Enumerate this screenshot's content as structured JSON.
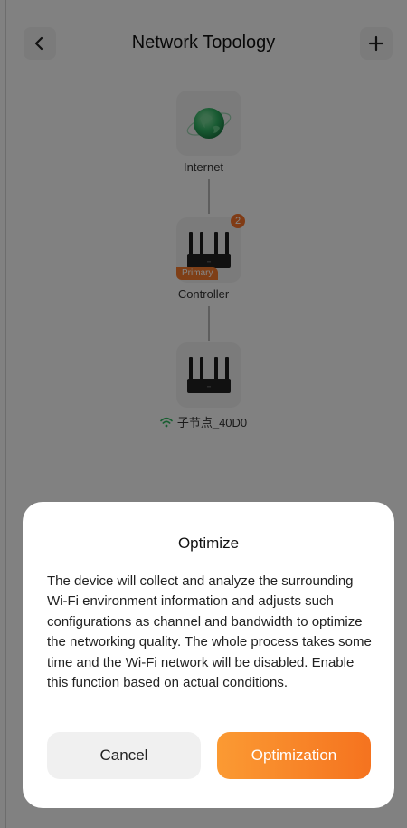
{
  "header": {
    "title": "Network Topology",
    "back_icon": "chevron-left-icon",
    "add_icon": "plus-icon"
  },
  "topology": {
    "internet_label": "Internet",
    "controller": {
      "label": "Controller",
      "badge_count": "2",
      "tag": "Primary"
    },
    "satellite": {
      "label": "子节点_40D0",
      "signal_icon": "wifi-icon"
    }
  },
  "dialog": {
    "title": "Optimize",
    "body": "The device will collect and analyze the surrounding Wi-Fi environment information and adjusts such configurations as channel and bandwidth to optimize the networking quality. The whole process takes some time and the Wi-Fi network will be disabled. Enable this function based on actual conditions.",
    "cancel_label": "Cancel",
    "confirm_label": "Optimization"
  },
  "colors": {
    "accent": "#f5731f",
    "wifi_green": "#2db55d"
  }
}
